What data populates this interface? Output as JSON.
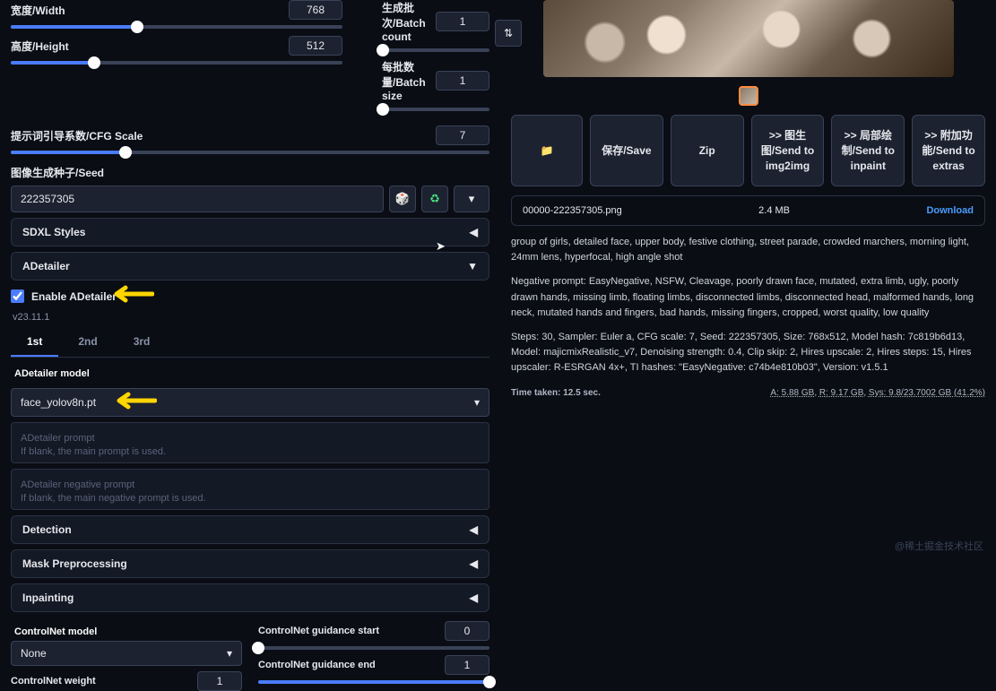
{
  "sliders": {
    "width": {
      "label": "宽度/Width",
      "value": 768,
      "pct": 38
    },
    "height": {
      "label": "高度/Height",
      "value": 512,
      "pct": 25
    },
    "batchCount": {
      "label": "生成批次/Batch count",
      "value": 1,
      "pct": 1
    },
    "batchSize": {
      "label": "每批数量/Batch size",
      "value": 1,
      "pct": 1
    },
    "cfg": {
      "label": "提示词引导系数/CFG Scale",
      "value": 7,
      "pct": 24
    },
    "cnStart": {
      "label": "ControlNet guidance start",
      "value": 0,
      "pct": 0
    },
    "cnEnd": {
      "label": "ControlNet guidance end",
      "value": 1,
      "pct": 100
    },
    "cnWeight": {
      "label": "ControlNet weight",
      "value": 1,
      "pct": 50
    }
  },
  "seed": {
    "label": "图像生成种子/Seed",
    "value": "222357305"
  },
  "accordions": {
    "sdxl": "SDXL Styles",
    "adetailer": "ADetailer",
    "detection": "Detection",
    "mask": "Mask Preprocessing",
    "inpaint": "Inpainting"
  },
  "adetailer": {
    "enableLabel": "Enable ADetailer",
    "version": "v23.11.1",
    "tabs": [
      "1st",
      "2nd",
      "3rd"
    ],
    "modelLabel": "ADetailer model",
    "modelValue": "face_yolov8n.pt",
    "promptPlaceholder": "ADetailer prompt\nIf blank, the main prompt is used.",
    "negPlaceholder": "ADetailer negative prompt\nIf blank, the main negative prompt is used.",
    "cnModelLabel": "ControlNet model",
    "cnModelValue": "None"
  },
  "actions": {
    "folder": "📁",
    "save": "保存/Save",
    "zip": "Zip",
    "img2img": ">> 图生图/Send to img2img",
    "inpaint": ">> 局部绘制/Send to inpaint",
    "extras": ">> 附加功能/Send to extras"
  },
  "file": {
    "name": "00000-222357305.png",
    "size": "2.4 MB",
    "download": "Download"
  },
  "prompt": "group of girls, detailed face, upper body, festive clothing, street parade, crowded marchers, morning light, 24mm lens, hyperfocal, high angle shot",
  "negPrompt": "Negative prompt: EasyNegative, NSFW, Cleavage, poorly drawn face, mutated, extra limb, ugly, poorly drawn hands, missing limb, floating limbs, disconnected limbs, disconnected head, malformed hands, long neck, mutated hands and fingers, bad hands, missing fingers, cropped, worst quality, low quality",
  "meta": "Steps: 30, Sampler: Euler a, CFG scale: 7, Seed: 222357305, Size: 768x512, Model hash: 7c819b6d13, Model: majicmixRealistic_v7, Denoising strength: 0.4, Clip skip: 2, Hires upscale: 2, Hires steps: 15, Hires upscaler: R-ESRGAN 4x+, TI hashes: \"EasyNegative: c74b4e810b03\", Version: v1.5.1",
  "time": "Time taken: 12.5 sec.",
  "vram": {
    "a": "A: 5.88 GB,",
    "r": "R: 9.17 GB,",
    "sys": "Sys: 9.8/23.7002 GB (41.2%)"
  },
  "watermark": "@稀土掘金技术社区"
}
